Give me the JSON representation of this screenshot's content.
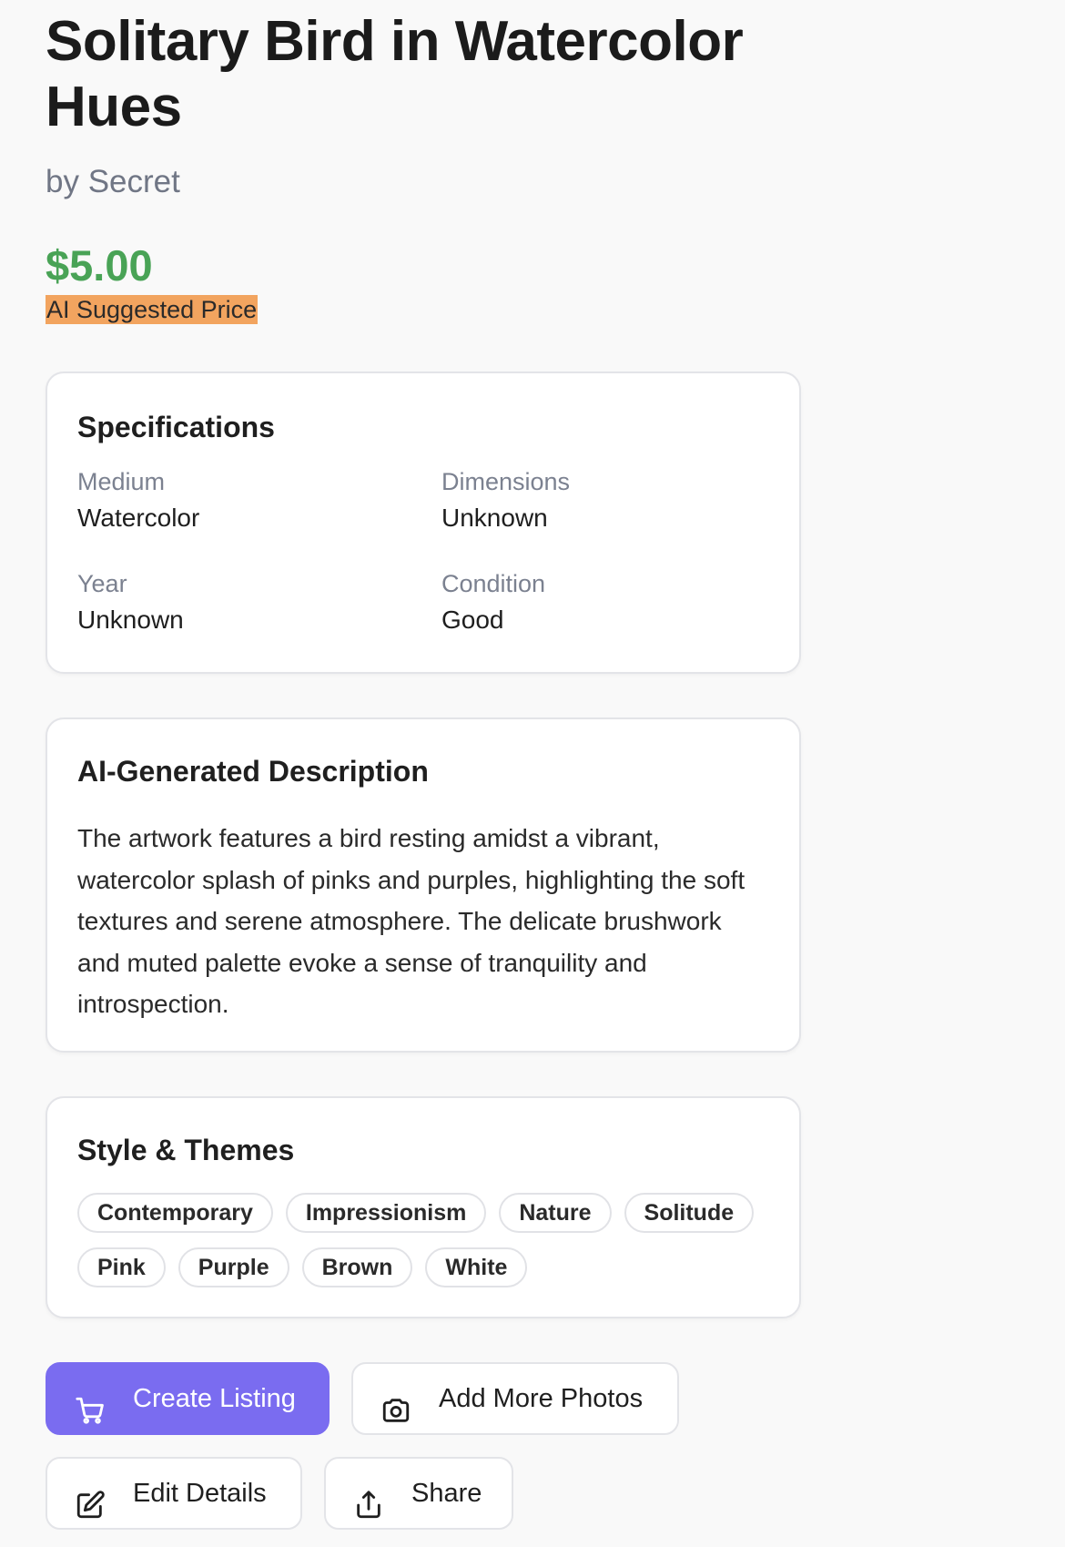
{
  "artwork": {
    "title_line1": "Solitary Bird in Watercolor",
    "title_line2": "Hues",
    "artist": "by Secret",
    "price": "$5.00",
    "price_badge": "AI Suggested Price"
  },
  "specifications": {
    "heading": "Specifications",
    "medium": {
      "label": "Medium",
      "value": "Watercolor"
    },
    "dimensions": {
      "label": "Dimensions",
      "value": "Unknown"
    },
    "year": {
      "label": "Year",
      "value": "Unknown"
    },
    "condition": {
      "label": "Condition",
      "value": "Good"
    }
  },
  "description": {
    "heading": "AI-Generated Description",
    "text": "The artwork features a bird resting amidst a vibrant, watercolor splash of pinks and purples, highlighting the soft textures and serene atmosphere. The delicate brushwork and muted palette evoke a sense of tranquility and introspection."
  },
  "themes": {
    "heading": "Style & Themes",
    "tags": [
      "Contemporary",
      "Impressionism",
      "Nature",
      "Solitude",
      "Pink",
      "Purple",
      "Brown",
      "White"
    ]
  },
  "actions": {
    "create_listing": {
      "label": "Create Listing",
      "icon": "cart-icon"
    },
    "add_photos": {
      "label": "Add More Photos",
      "icon": "camera-icon"
    },
    "edit_details": {
      "label": "Edit Details",
      "icon": "edit-icon"
    },
    "share": {
      "label": "Share",
      "icon": "share-icon"
    }
  },
  "colors": {
    "price": "#49a356",
    "badge": "#f2a45f",
    "primary_button": "#7a6cf0"
  }
}
